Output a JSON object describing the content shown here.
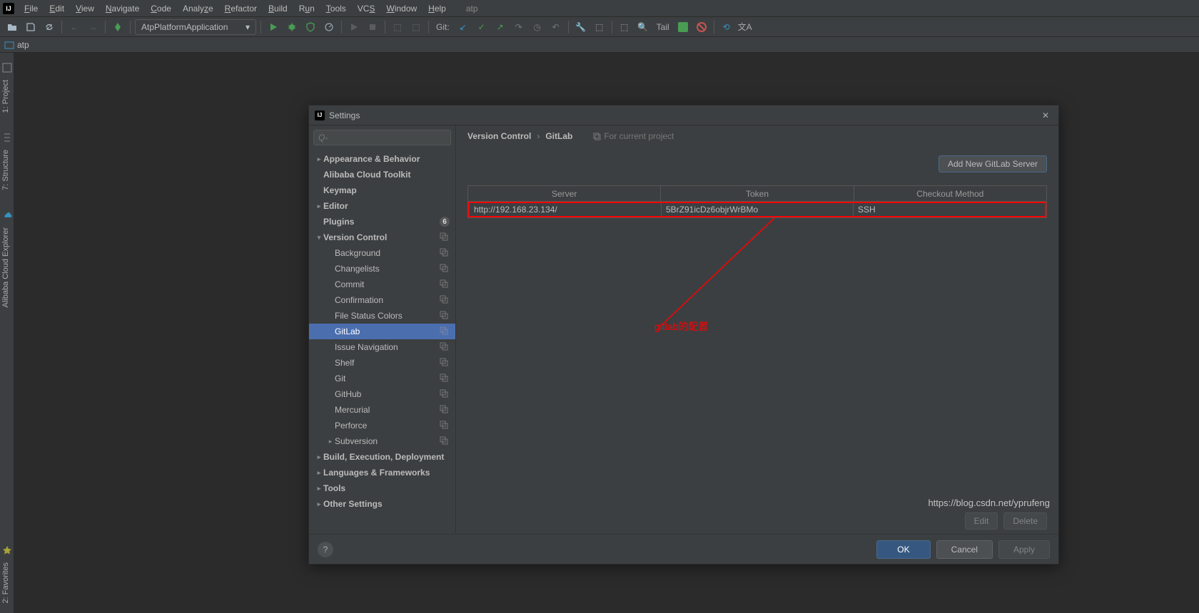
{
  "menubar": {
    "items": [
      "File",
      "Edit",
      "View",
      "Navigate",
      "Code",
      "Analyze",
      "Refactor",
      "Build",
      "Run",
      "Tools",
      "VCS",
      "Window",
      "Help"
    ],
    "project": "atp"
  },
  "toolbar": {
    "run_config": "AtpPlatformApplication",
    "git_label": "Git:",
    "tail_label": "Tail"
  },
  "nav": {
    "root": "atp"
  },
  "left_tool_tabs": [
    "1: Project",
    "7: Structure",
    "Alibaba Cloud Explorer",
    "2: Favorites"
  ],
  "dialog": {
    "title": "Settings",
    "search_placeholder": "Q-",
    "tree": [
      {
        "label": "Appearance & Behavior",
        "bold": true,
        "arrow": ">"
      },
      {
        "label": "Alibaba Cloud Toolkit",
        "bold": true,
        "arrow": ""
      },
      {
        "label": "Keymap",
        "bold": true,
        "arrow": ""
      },
      {
        "label": "Editor",
        "bold": true,
        "arrow": ">"
      },
      {
        "label": "Plugins",
        "bold": true,
        "arrow": "",
        "badge": "6"
      },
      {
        "label": "Version Control",
        "bold": true,
        "arrow": "v",
        "cp": true
      },
      {
        "label": "Background",
        "indent": 1,
        "cp": true
      },
      {
        "label": "Changelists",
        "indent": 1,
        "cp": true
      },
      {
        "label": "Commit",
        "indent": 1,
        "cp": true
      },
      {
        "label": "Confirmation",
        "indent": 1,
        "cp": true
      },
      {
        "label": "File Status Colors",
        "indent": 1,
        "cp": true
      },
      {
        "label": "GitLab",
        "indent": 1,
        "cp": true,
        "selected": true
      },
      {
        "label": "Issue Navigation",
        "indent": 1,
        "cp": true
      },
      {
        "label": "Shelf",
        "indent": 1,
        "cp": true
      },
      {
        "label": "Git",
        "indent": 1,
        "cp": true
      },
      {
        "label": "GitHub",
        "indent": 1,
        "cp": true
      },
      {
        "label": "Mercurial",
        "indent": 1,
        "cp": true
      },
      {
        "label": "Perforce",
        "indent": 1,
        "cp": true
      },
      {
        "label": "Subversion",
        "indent": 1,
        "arrow": ">",
        "cp": true
      },
      {
        "label": "Build, Execution, Deployment",
        "bold": true,
        "arrow": ">"
      },
      {
        "label": "Languages & Frameworks",
        "bold": true,
        "arrow": ">"
      },
      {
        "label": "Tools",
        "bold": true,
        "arrow": ">"
      },
      {
        "label": "Other Settings",
        "bold": true,
        "arrow": ">"
      }
    ],
    "breadcrumb": {
      "a": "Version Control",
      "b": "GitLab",
      "hint": "For current project"
    },
    "add_btn": "Add New GitLab Server",
    "table": {
      "headers": [
        "Server",
        "Token",
        "Checkout Method"
      ],
      "row": [
        "http://192.168.23.134/",
        "5BrZ91icDz6objrWrBMo",
        "SSH"
      ]
    },
    "annotation": "gitlab的配置",
    "edit": "Edit",
    "delete": "Delete",
    "help": "?",
    "ok": "OK",
    "cancel": "Cancel",
    "apply": "Apply"
  },
  "watermark": "https://blog.csdn.net/yprufeng"
}
